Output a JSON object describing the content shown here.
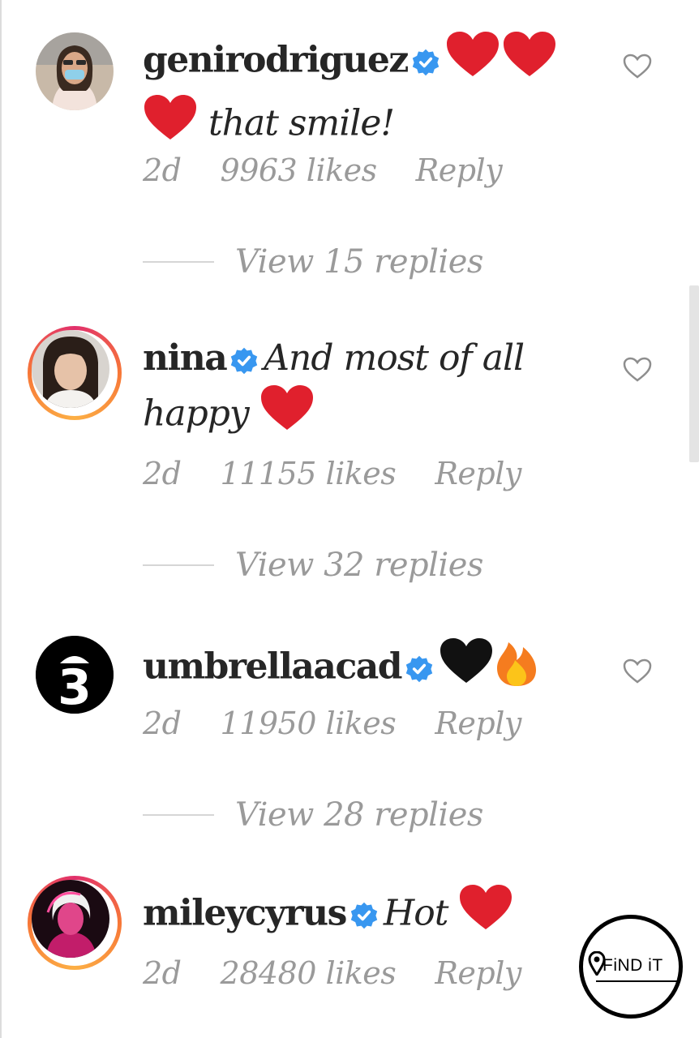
{
  "comments": [
    {
      "username": "genirodriguez",
      "verified": true,
      "line1_emojis": "❤️❤️",
      "line2_emoji": "❤️",
      "message": "that smile!",
      "age": "2d",
      "likes": "9963 likes",
      "reply_label": "Reply",
      "view_replies": "View 15 replies",
      "avatar_icon": "person-avatar-sunglasses"
    },
    {
      "username": "nina",
      "verified": true,
      "message": "And most of all",
      "message_line2": "happy",
      "emoji": "❤️",
      "age": "2d",
      "likes": "11155 likes",
      "reply_label": "Reply",
      "view_replies": "View 32 replies",
      "avatar_icon": "child-portrait-avatar",
      "has_story_ring": true
    },
    {
      "username": "umbrellaacad",
      "verified": true,
      "emojis": "🖤🔥",
      "age": "2d",
      "likes": "11950 likes",
      "reply_label": "Reply",
      "view_replies": "View 28 replies",
      "avatar_text": "3",
      "avatar_icon": "umbrella-academy-3-logo"
    },
    {
      "username": "mileycyrus",
      "verified": true,
      "message": "Hot",
      "emoji": "❤️",
      "age": "2d",
      "likes": "28480 likes",
      "reply_label": "Reply",
      "avatar_icon": "pink-portrait-avatar",
      "has_story_ring": true
    }
  ],
  "watermark": {
    "text": "FiND iT",
    "icon": "location-pin-icon"
  },
  "colors": {
    "verified_blue": "#3897f0",
    "heart_red": "#e0202d",
    "meta_gray": "#9a9a9a",
    "story_ring": "#e1306c"
  }
}
